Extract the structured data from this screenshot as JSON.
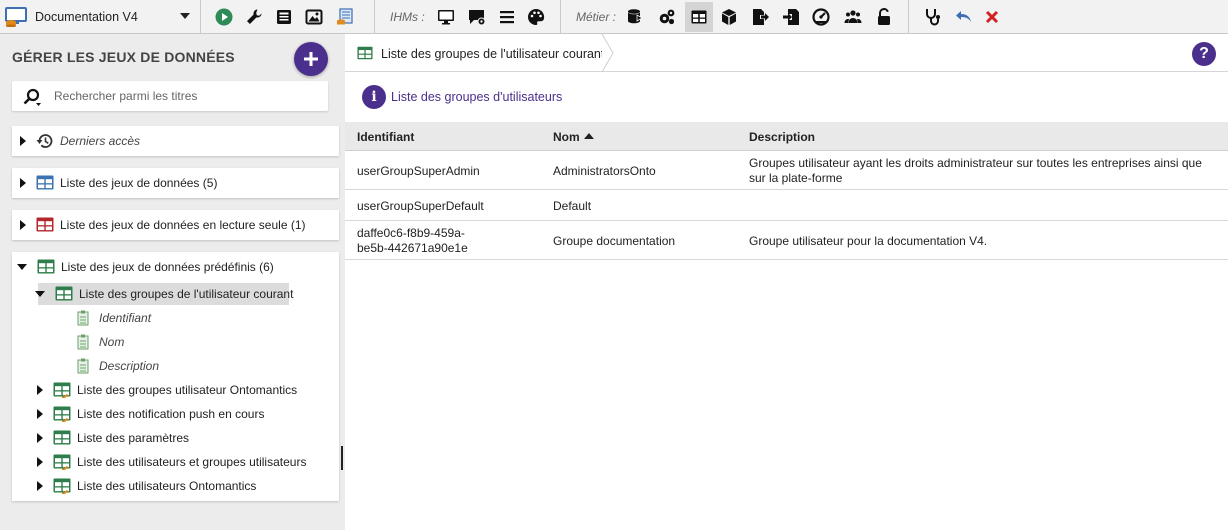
{
  "project": {
    "name": "Documentation V4"
  },
  "toolbar": {
    "ihms_label": "IHMs :",
    "metier_label": "Métier :"
  },
  "left": {
    "title": "GÉRER LES JEUX DE DONNÉES",
    "search_placeholder": "Rechercher parmi les titres",
    "sections": {
      "recent": "Derniers accès",
      "datasets": "Liste des jeux de données (5)",
      "readonly": "Liste des jeux de données en lecture seule (1)",
      "predefined": "Liste des jeux de données prédéfinis (6)"
    },
    "predefined_items": [
      {
        "label": "Liste des groupes de l'utilisateur courant",
        "children": [
          "Identifiant",
          "Nom",
          "Description"
        ]
      },
      {
        "label": "Liste des groupes utilisateur Ontomantics"
      },
      {
        "label": "Liste des notification push en cours"
      },
      {
        "label": "Liste des paramètres"
      },
      {
        "label": "Liste des utilisateurs et groupes utilisateurs"
      },
      {
        "label": "Liste des utilisateurs Ontomantics"
      }
    ]
  },
  "right": {
    "tab_label": "Liste des groupes de l'utilisateur courant",
    "help": "?",
    "info": {
      "glyph": "i",
      "text": "Liste des groupes d'utilisateurs"
    },
    "table": {
      "columns": [
        "Identifiant",
        "Nom",
        "Description"
      ],
      "rows": [
        {
          "id": "userGroupSuperAdmin",
          "nom": "AdministratorsOnto",
          "desc1": "Groupes utilisateur ayant les droits administrateur sur toutes les entreprises ainsi que",
          "desc2": "sur la plate-forme"
        },
        {
          "id": "userGroupSuperDefault",
          "nom": "Default",
          "desc1": "",
          "desc2": ""
        },
        {
          "id1": "daffe0c6-f8b9-459a-",
          "id2": "be5b-442671a90e1e",
          "nom": "Groupe documentation",
          "desc1": "Groupe utilisateur pour la documentation V4."
        }
      ]
    }
  },
  "colors": {
    "accent": "#4b2f8c",
    "dataset_blue": "#3a73b0",
    "dataset_red": "#b3262c",
    "dataset_green": "#2e7d4a",
    "close_red": "#d32020",
    "undo_blue": "#3d6fb5"
  },
  "icons": [
    "project-logo-icon",
    "play-icon",
    "wrench-icon",
    "book-icon",
    "image-icon",
    "document-icon",
    "monitor-icon",
    "chat-settings-icon",
    "menu-icon",
    "palette-icon",
    "database-arrow-icon",
    "cogs-icon",
    "table-icon",
    "cube-icon",
    "export-icon",
    "import-icon",
    "stethoscope-icon",
    "undo-icon",
    "close-icon",
    "history-icon"
  ]
}
